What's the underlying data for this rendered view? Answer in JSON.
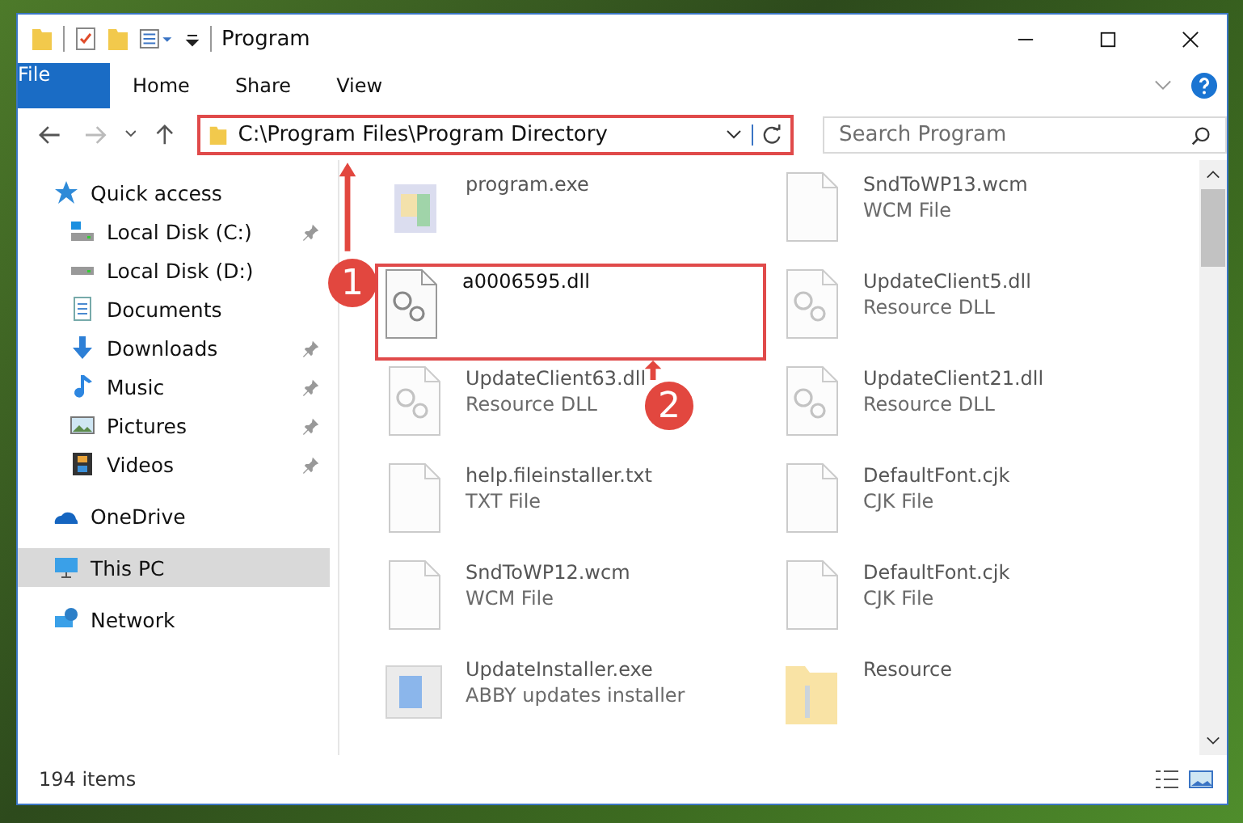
{
  "window": {
    "title": "Program"
  },
  "ribbon_tabs": [
    {
      "label": "File",
      "kind": "file"
    },
    {
      "label": "Home",
      "kind": "tab"
    },
    {
      "label": "Share",
      "kind": "tab"
    },
    {
      "label": "View",
      "kind": "tab"
    }
  ],
  "address": {
    "path": "C:\\Program Files\\Program Directory"
  },
  "search": {
    "placeholder": "Search Program"
  },
  "sidebar": {
    "items": [
      {
        "label": "Quick access",
        "kind": "star",
        "selected": false,
        "children": [
          {
            "label": "Local Disk (C:)",
            "kind": "disk-win",
            "pinned": true,
            "selected": false
          },
          {
            "label": "Local Disk (D:)",
            "kind": "disk",
            "pinned": false,
            "selected": false
          },
          {
            "label": "Documents",
            "kind": "doc",
            "pinned": false,
            "selected": false
          },
          {
            "label": "Downloads",
            "kind": "download",
            "pinned": true,
            "selected": false
          },
          {
            "label": "Music",
            "kind": "music",
            "pinned": true,
            "selected": false
          },
          {
            "label": "Pictures",
            "kind": "pictures",
            "pinned": true,
            "selected": false
          },
          {
            "label": "Videos",
            "kind": "videos",
            "pinned": true,
            "selected": false
          }
        ]
      },
      {
        "label": "OneDrive",
        "kind": "cloud",
        "selected": false
      },
      {
        "label": "This PC",
        "kind": "pc",
        "selected": true
      },
      {
        "label": "Network",
        "kind": "network",
        "selected": false
      }
    ]
  },
  "files": [
    {
      "name": "program.exe",
      "kind": "exe",
      "highlighted": false
    },
    {
      "name": "SndToWP13.wcm",
      "type": "WCM File",
      "kind": "blank",
      "highlighted": false
    },
    {
      "name": "a0006595.dll",
      "kind": "dll",
      "highlighted": true
    },
    {
      "name": "UpdateClient5.dll",
      "type": "Resource DLL",
      "kind": "dll",
      "highlighted": false
    },
    {
      "name": "UpdateClient63.dll",
      "type": "Resource DLL",
      "kind": "dll",
      "highlighted": false
    },
    {
      "name": "UpdateClient21.dll",
      "type": "Resource DLL",
      "kind": "dll",
      "highlighted": false
    },
    {
      "name": "help.fileinstaller.txt",
      "type": "TXT File",
      "kind": "blank",
      "highlighted": false
    },
    {
      "name": "DefaultFont.cjk",
      "type": "CJK File",
      "kind": "blank",
      "highlighted": false
    },
    {
      "name": "SndToWP12.wcm",
      "type": "WCM File",
      "kind": "blank",
      "highlighted": false
    },
    {
      "name": "DefaultFont.cjk",
      "type": "CJK File",
      "kind": "blank",
      "highlighted": false
    },
    {
      "name": "UpdateInstaller.exe",
      "type": "ABBY updates installer",
      "kind": "installer",
      "highlighted": false
    },
    {
      "name": "Resource",
      "kind": "folder",
      "highlighted": false
    }
  ],
  "annotations": [
    {
      "number": "1"
    },
    {
      "number": "2"
    }
  ],
  "status_bar": {
    "count": "194 items"
  }
}
